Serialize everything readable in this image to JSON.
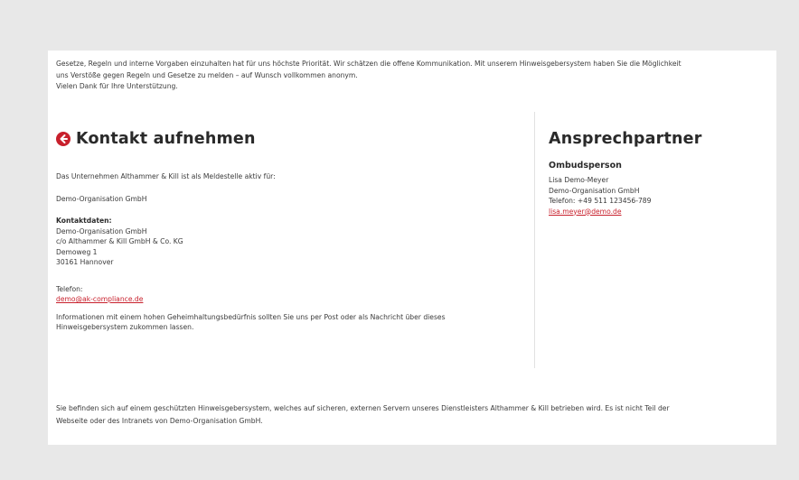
{
  "intro": {
    "line1": "Gesetze, Regeln und interne Vorgaben einzuhalten hat für uns höchste Priorität. Wir schätzen die offene Kommunikation. Mit unserem Hinweisgebersystem haben Sie die Möglichkeit",
    "line2": "uns Verstöße gegen Regeln und Gesetze zu melden – auf Wunsch vollkommen anonym.",
    "line3": "Vielen Dank für Ihre Unterstützung."
  },
  "contact": {
    "heading": "Kontakt aufnehmen",
    "registry_text": "Das Unternehmen Althammer & Kill ist als Meldestelle aktiv für:",
    "organisation": "Demo-Organisation GmbH",
    "details_label": "Kontaktdaten:",
    "address": [
      "Demo-Organisation GmbH",
      "c/o Althammer & Kill GmbH & Co. KG",
      "Demoweg 1",
      "30161 Hannover"
    ],
    "phone_label": "Telefon:",
    "email": "demo@ak-compliance.de",
    "confidential_line1": "Informationen mit einem hohen Geheimhaltungsbedürfnis sollten Sie uns per Post oder als Nachricht über dieses",
    "confidential_line2": "Hinweisgebersystem zukommen lassen."
  },
  "partner": {
    "heading": "Ansprechpartner",
    "role": "Ombudsperson",
    "name": "Lisa Demo-Meyer",
    "org": "Demo-Organisation GmbH",
    "phone": "Telefon: +49 511 123456-789",
    "email": "lisa.meyer@demo.de"
  },
  "footer": {
    "line1": "Sie befinden sich auf einem geschützten Hinweisgebersystem, welches auf sicheren, externen Servern unseres Dienstleisters Althammer & Kill betrieben wird. Es ist nicht Teil der",
    "line2": "Webseite oder des Intranets von Demo-Organisation GmbH."
  },
  "colors": {
    "accent": "#c8202c",
    "background": "#e8e8e8",
    "card": "#ffffff"
  },
  "icons": {
    "heading_icon": "arrow-left-circle-icon"
  }
}
